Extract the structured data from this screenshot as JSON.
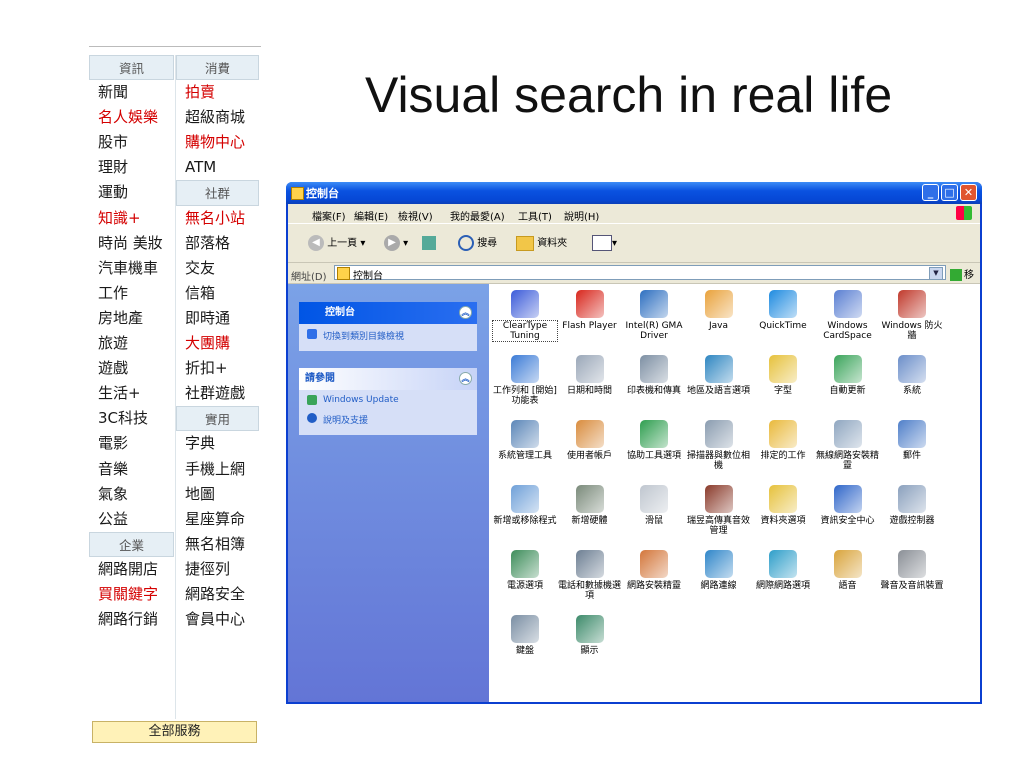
{
  "slide": {
    "title": "Visual search in real life"
  },
  "portal": {
    "left": [
      {
        "text": "資訊",
        "kind": "hdr"
      },
      {
        "text": "新聞"
      },
      {
        "text": "名人娛樂",
        "kind": "red"
      },
      {
        "text": "股市"
      },
      {
        "text": "理財"
      },
      {
        "text": "運動"
      },
      {
        "text": "知識+",
        "kind": "red"
      },
      {
        "text": "時尚 美妝"
      },
      {
        "text": "汽車機車"
      },
      {
        "text": "工作"
      },
      {
        "text": "房地產"
      },
      {
        "text": "旅遊"
      },
      {
        "text": "遊戲"
      },
      {
        "text": "生活+"
      },
      {
        "text": "3C科技"
      },
      {
        "text": "電影"
      },
      {
        "text": "音樂"
      },
      {
        "text": "氣象"
      },
      {
        "text": "公益"
      },
      {
        "text": "企業",
        "kind": "hdr"
      },
      {
        "text": "網路開店"
      },
      {
        "text": "買關鍵字",
        "kind": "red"
      },
      {
        "text": "網路行銷"
      }
    ],
    "right": [
      {
        "text": "消費",
        "kind": "hdr"
      },
      {
        "text": "拍賣",
        "kind": "red"
      },
      {
        "text": "超級商城"
      },
      {
        "text": "購物中心",
        "kind": "red"
      },
      {
        "text": "ATM"
      },
      {
        "text": "社群",
        "kind": "hdr"
      },
      {
        "text": "無名小站",
        "kind": "red"
      },
      {
        "text": "部落格"
      },
      {
        "text": "交友"
      },
      {
        "text": "信箱"
      },
      {
        "text": "即時通"
      },
      {
        "text": "大團購",
        "kind": "red"
      },
      {
        "text": "折扣+"
      },
      {
        "text": "社群遊戲"
      },
      {
        "text": "實用",
        "kind": "hdr"
      },
      {
        "text": "字典"
      },
      {
        "text": "手機上網"
      },
      {
        "text": "地圖"
      },
      {
        "text": "星座算命"
      },
      {
        "text": "無名相簿"
      },
      {
        "text": "捷徑列"
      },
      {
        "text": "網路安全"
      },
      {
        "text": "會員中心"
      }
    ],
    "all_services": "全部服務"
  },
  "window": {
    "title": "控制台",
    "menu": [
      "檔案(F)",
      "編輯(E)",
      "檢視(V)",
      "我的最愛(A)",
      "工具(T)",
      "說明(H)"
    ],
    "toolbar": {
      "back": "上一頁",
      "search": "搜尋",
      "folders": "資料夾"
    },
    "address": {
      "label": "網址(D)",
      "value": "控制台",
      "go": "移至"
    },
    "taskpane": {
      "panel1": {
        "title": "控制台",
        "items": [
          "切換到類別目錄檢視"
        ]
      },
      "panel2": {
        "title": "請參閱",
        "items": [
          "Windows Update",
          "說明及支援"
        ]
      }
    },
    "icons": [
      {
        "label": "ClearType Tuning",
        "color": "#3b5bd9",
        "sel": true
      },
      {
        "label": "Flash Player",
        "color": "#d8261c"
      },
      {
        "label": "Intel(R) GMA Driver",
        "color": "#2d6fc0"
      },
      {
        "label": "Java",
        "color": "#e9a23b"
      },
      {
        "label": "QuickTime",
        "color": "#1e8be0"
      },
      {
        "label": "Windows CardSpace",
        "color": "#5a7fd2"
      },
      {
        "label": "Windows 防火牆",
        "color": "#c0392b"
      },
      {
        "label": "工作列和 [開始] 功能表",
        "color": "#3b7bd6"
      },
      {
        "label": "日期和時間",
        "color": "#9aa7b8"
      },
      {
        "label": "印表機和傳真",
        "color": "#7d8fa3"
      },
      {
        "label": "地區及語言選項",
        "color": "#2e86c1"
      },
      {
        "label": "字型",
        "color": "#e6c13b"
      },
      {
        "label": "自動更新",
        "color": "#3aa45a"
      },
      {
        "label": "系統",
        "color": "#6b8ec9"
      },
      {
        "label": "系統管理工具",
        "color": "#5b86b8"
      },
      {
        "label": "使用者帳戶",
        "color": "#d98c3d"
      },
      {
        "label": "協助工具選項",
        "color": "#2e9e4f"
      },
      {
        "label": "掃描器與數位相機",
        "color": "#8a9cb0"
      },
      {
        "label": "排定的工作",
        "color": "#e9b93b"
      },
      {
        "label": "無線網路安裝精靈",
        "color": "#8fa6c0"
      },
      {
        "label": "郵件",
        "color": "#4f7fc9"
      },
      {
        "label": "新增或移除程式",
        "color": "#6fa0d8"
      },
      {
        "label": "新增硬體",
        "color": "#7a8a7a"
      },
      {
        "label": "滑鼠",
        "color": "#bfc6cf"
      },
      {
        "label": "瑞昱高傳真音效管理",
        "color": "#8a3a2a"
      },
      {
        "label": "資料夾選項",
        "color": "#e6c13b"
      },
      {
        "label": "資訊安全中心",
        "color": "#2f66c9"
      },
      {
        "label": "遊戲控制器",
        "color": "#8aa0bd"
      },
      {
        "label": "電源選項",
        "color": "#3d8d5a"
      },
      {
        "label": "電話和數據機選項",
        "color": "#6d7f93"
      },
      {
        "label": "網路安裝精靈",
        "color": "#d3763a"
      },
      {
        "label": "網路連線",
        "color": "#2f86c9"
      },
      {
        "label": "網際網路選項",
        "color": "#2e9ec9"
      },
      {
        "label": "語音",
        "color": "#d9a43b"
      },
      {
        "label": "聲音及音訊裝置",
        "color": "#8a8f96"
      },
      {
        "label": "鍵盤",
        "color": "#7a8ea3"
      },
      {
        "label": "顯示",
        "color": "#3c8a6a"
      }
    ]
  }
}
